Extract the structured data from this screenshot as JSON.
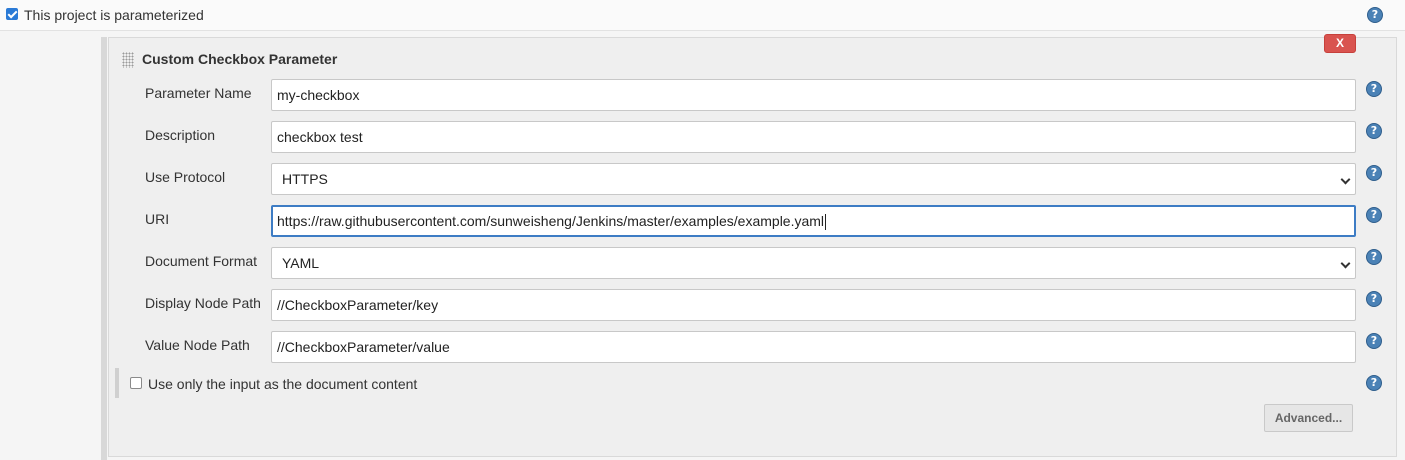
{
  "parameterized": {
    "checked": true,
    "label": "This project is parameterized"
  },
  "help_glyph": "?",
  "parameter": {
    "title": "Custom Checkbox Parameter",
    "delete_label": "X",
    "fields": {
      "name": {
        "label": "Parameter Name",
        "value": "my-checkbox"
      },
      "description": {
        "label": "Description",
        "value": "checkbox test"
      },
      "protocol": {
        "label": "Use Protocol",
        "value": "HTTPS"
      },
      "uri": {
        "label": "URI",
        "value": "https://raw.githubusercontent.com/sunweisheng/Jenkins/master/examples/example.yaml"
      },
      "format": {
        "label": "Document Format",
        "value": "YAML"
      },
      "display_path": {
        "label": "Display Node Path",
        "value": "//CheckboxParameter/key"
      },
      "value_path": {
        "label": "Value Node Path",
        "value": "//CheckboxParameter/value"
      }
    },
    "use_input_only": {
      "checked": false,
      "label": "Use only the input as the document content"
    },
    "advanced_label": "Advanced..."
  },
  "colors": {
    "delete_button": "#d9534f",
    "help_icon": "#4b82b6",
    "checkbox_checked": "#2a7ad6",
    "focus_border": "#3d7cc4"
  }
}
